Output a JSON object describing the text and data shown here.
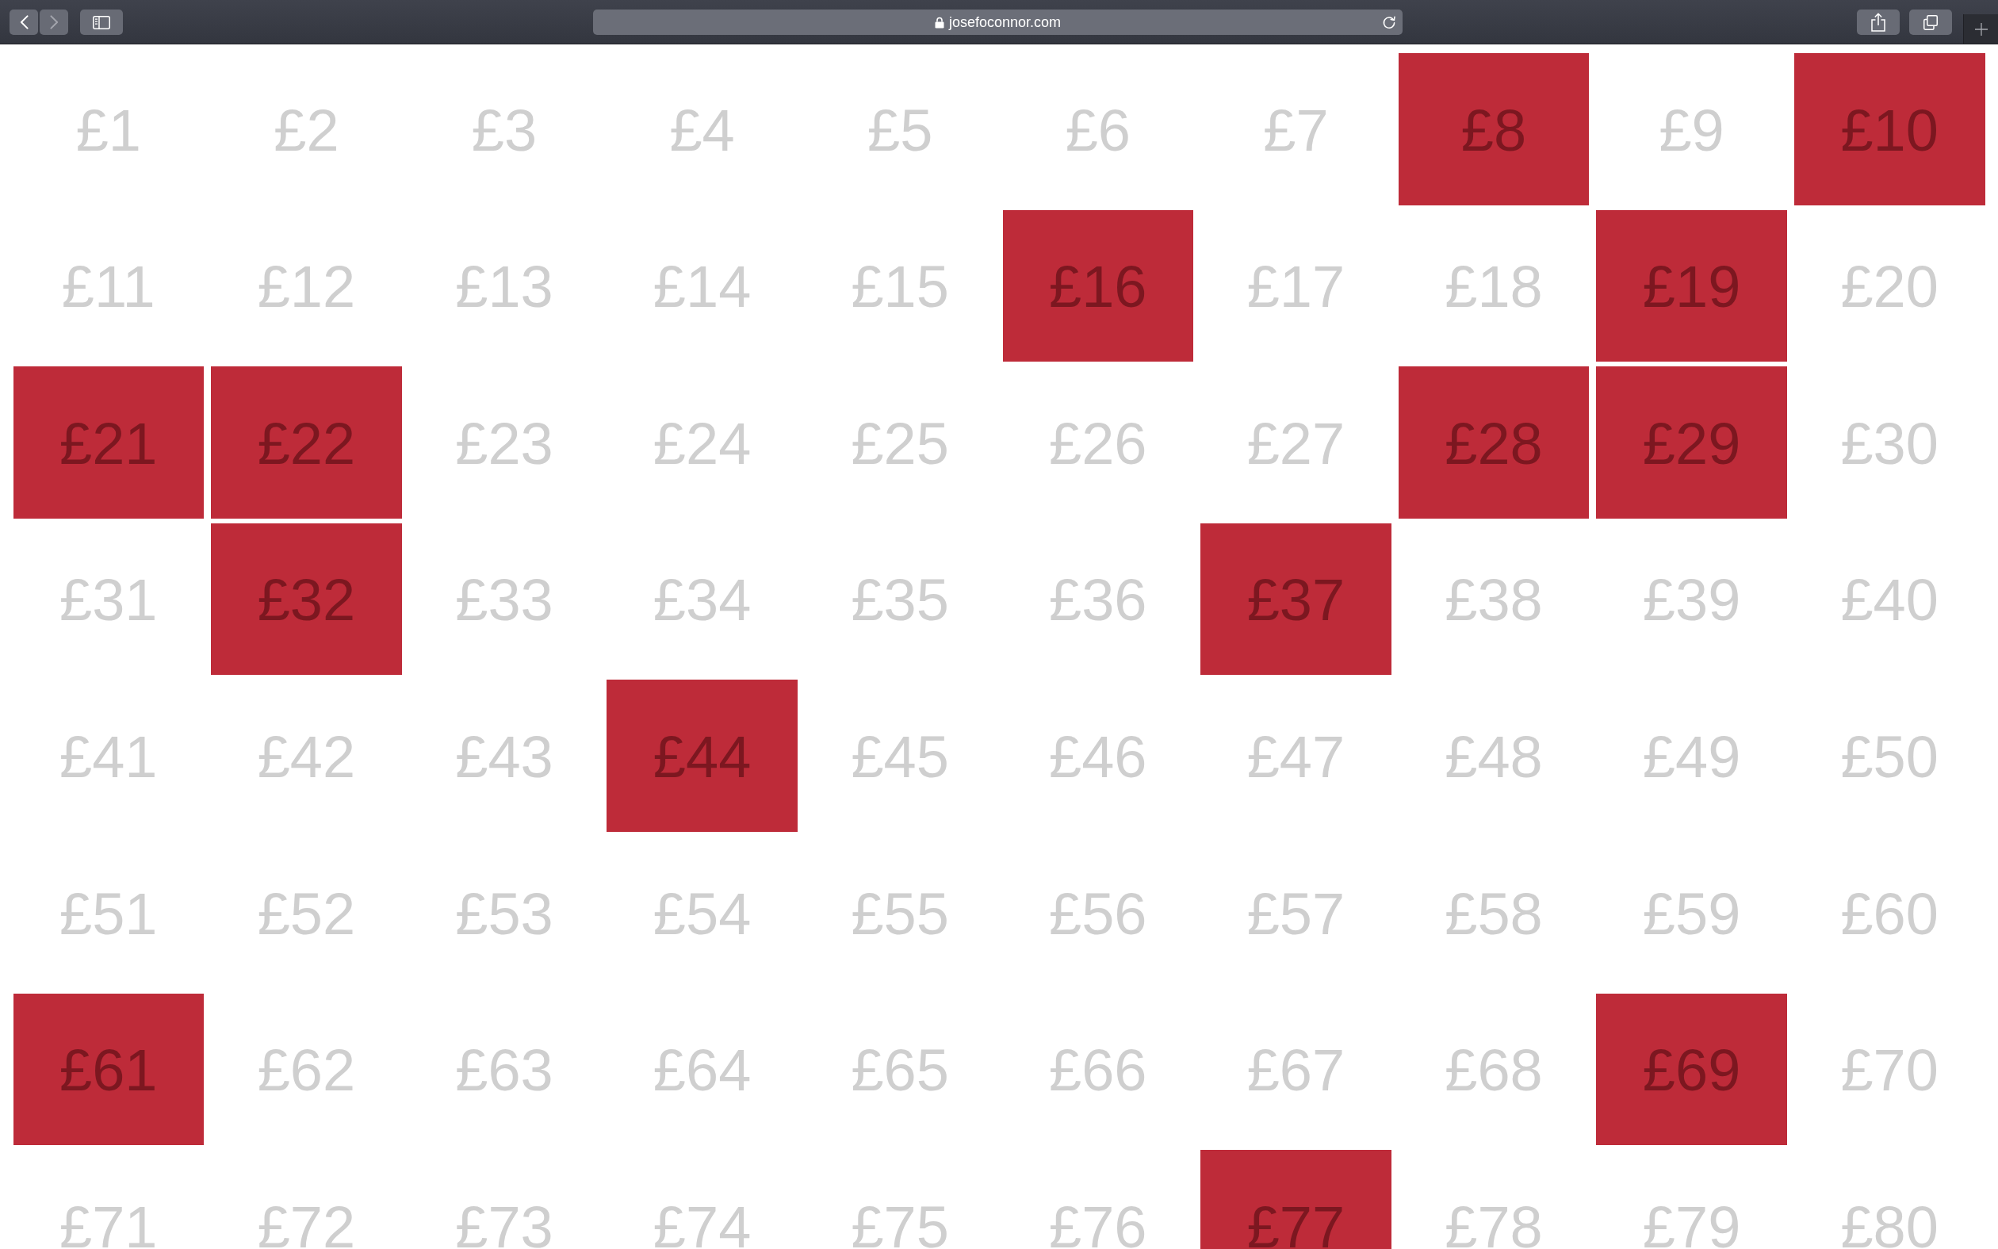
{
  "toolbar": {
    "nav_buttons": [
      {
        "kind": "back",
        "disabled": false
      },
      {
        "kind": "forward",
        "disabled": true
      }
    ],
    "address": "josefoconnor.com"
  },
  "tiles": [
    {
      "label": "£1",
      "selected": false
    },
    {
      "label": "£2",
      "selected": false
    },
    {
      "label": "£3",
      "selected": false
    },
    {
      "label": "£4",
      "selected": false
    },
    {
      "label": "£5",
      "selected": false
    },
    {
      "label": "£6",
      "selected": false
    },
    {
      "label": "£7",
      "selected": false
    },
    {
      "label": "£8",
      "selected": true
    },
    {
      "label": "£9",
      "selected": false
    },
    {
      "label": "£10",
      "selected": true
    },
    {
      "label": "£11",
      "selected": false
    },
    {
      "label": "£12",
      "selected": false
    },
    {
      "label": "£13",
      "selected": false
    },
    {
      "label": "£14",
      "selected": false
    },
    {
      "label": "£15",
      "selected": false
    },
    {
      "label": "£16",
      "selected": true
    },
    {
      "label": "£17",
      "selected": false
    },
    {
      "label": "£18",
      "selected": false
    },
    {
      "label": "£19",
      "selected": true
    },
    {
      "label": "£20",
      "selected": false
    },
    {
      "label": "£21",
      "selected": true
    },
    {
      "label": "£22",
      "selected": true
    },
    {
      "label": "£23",
      "selected": false
    },
    {
      "label": "£24",
      "selected": false
    },
    {
      "label": "£25",
      "selected": false
    },
    {
      "label": "£26",
      "selected": false
    },
    {
      "label": "£27",
      "selected": false
    },
    {
      "label": "£28",
      "selected": true
    },
    {
      "label": "£29",
      "selected": true
    },
    {
      "label": "£30",
      "selected": false
    },
    {
      "label": "£31",
      "selected": false
    },
    {
      "label": "£32",
      "selected": true
    },
    {
      "label": "£33",
      "selected": false
    },
    {
      "label": "£34",
      "selected": false
    },
    {
      "label": "£35",
      "selected": false
    },
    {
      "label": "£36",
      "selected": false
    },
    {
      "label": "£37",
      "selected": true
    },
    {
      "label": "£38",
      "selected": false
    },
    {
      "label": "£39",
      "selected": false
    },
    {
      "label": "£40",
      "selected": false
    },
    {
      "label": "£41",
      "selected": false
    },
    {
      "label": "£42",
      "selected": false
    },
    {
      "label": "£43",
      "selected": false
    },
    {
      "label": "£44",
      "selected": true
    },
    {
      "label": "£45",
      "selected": false
    },
    {
      "label": "£46",
      "selected": false
    },
    {
      "label": "£47",
      "selected": false
    },
    {
      "label": "£48",
      "selected": false
    },
    {
      "label": "£49",
      "selected": false
    },
    {
      "label": "£50",
      "selected": false
    },
    {
      "label": "£51",
      "selected": false
    },
    {
      "label": "£52",
      "selected": false
    },
    {
      "label": "£53",
      "selected": false
    },
    {
      "label": "£54",
      "selected": false
    },
    {
      "label": "£55",
      "selected": false
    },
    {
      "label": "£56",
      "selected": false
    },
    {
      "label": "£57",
      "selected": false
    },
    {
      "label": "£58",
      "selected": false
    },
    {
      "label": "£59",
      "selected": false
    },
    {
      "label": "£60",
      "selected": false
    },
    {
      "label": "£61",
      "selected": true
    },
    {
      "label": "£62",
      "selected": false
    },
    {
      "label": "£63",
      "selected": false
    },
    {
      "label": "£64",
      "selected": false
    },
    {
      "label": "£65",
      "selected": false
    },
    {
      "label": "£66",
      "selected": false
    },
    {
      "label": "£67",
      "selected": false
    },
    {
      "label": "£68",
      "selected": false
    },
    {
      "label": "£69",
      "selected": true
    },
    {
      "label": "£70",
      "selected": false
    },
    {
      "label": "£71",
      "selected": false
    },
    {
      "label": "£72",
      "selected": false
    },
    {
      "label": "£73",
      "selected": false
    },
    {
      "label": "£74",
      "selected": false
    },
    {
      "label": "£75",
      "selected": false
    },
    {
      "label": "£76",
      "selected": false
    },
    {
      "label": "£77",
      "selected": true
    },
    {
      "label": "£78",
      "selected": false
    },
    {
      "label": "£79",
      "selected": false
    },
    {
      "label": "£80",
      "selected": false
    }
  ]
}
